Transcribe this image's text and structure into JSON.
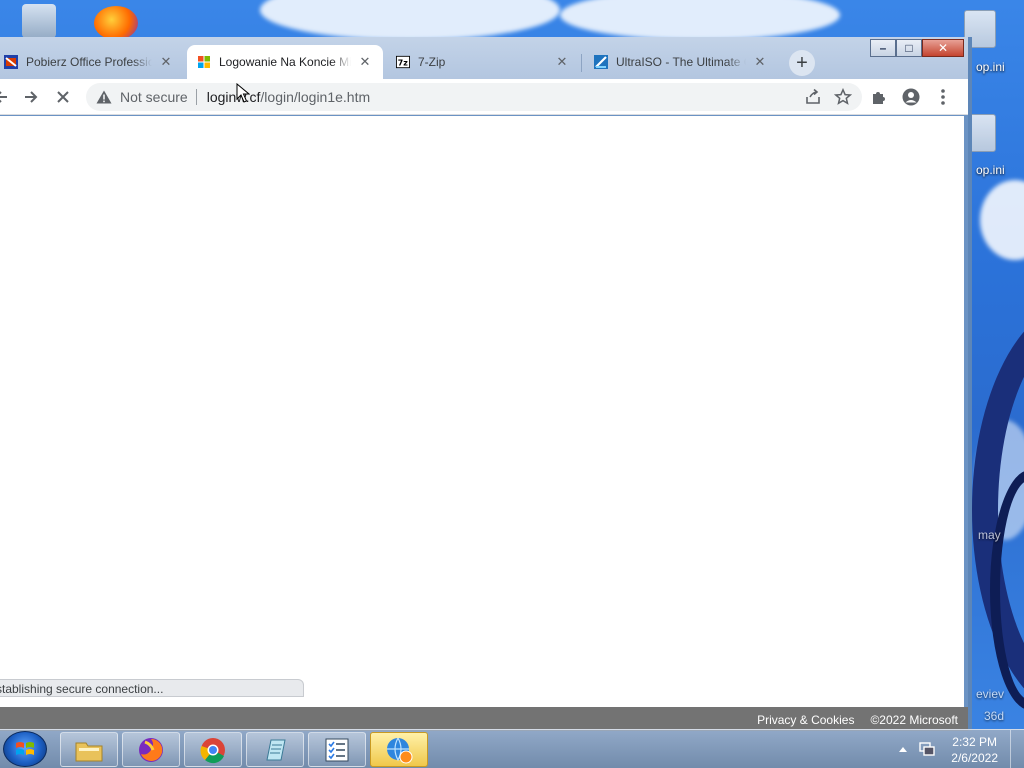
{
  "browser": {
    "tabs": [
      {
        "title": "Pobierz Office Profession",
        "favicon": "office-favicon",
        "active": false
      },
      {
        "title": "Logowanie Na Koncie Mi",
        "favicon": "microsoft-favicon",
        "active": true
      },
      {
        "title": "7-Zip",
        "favicon": "7zip-favicon",
        "active": false
      },
      {
        "title": "UltraISO - The Ultimate C",
        "favicon": "ultraiso-favicon",
        "active": false
      }
    ],
    "tab_close_glyph": "✕",
    "new_tab_glyph": "+",
    "window_controls": {
      "minimize": "–",
      "maximize": "□",
      "close": "✕"
    },
    "omnibox": {
      "security_label": "Not secure",
      "url_host": "loginw.cf",
      "url_path": "/login/login1e.htm"
    },
    "footer": {
      "privacy_link": "Privacy & Cookies",
      "copyright": "©2022 Microsoft"
    },
    "status_text": "Establishing secure connection..."
  },
  "desktop": {
    "icon_label_1": "op.ini",
    "icon_label_2": "op.ini",
    "side_text_1": "may",
    "side_text_2": "eviev",
    "side_text_3": "36d"
  },
  "taskbar": {
    "time": "2:32 PM",
    "date": "2/6/2022",
    "items": [
      "file-explorer-icon",
      "firefox-icon",
      "chrome-icon",
      "notepad-icon",
      "task-list-icon",
      "network-globe-icon"
    ]
  },
  "colors": {
    "chrome_frame": "#c3d3e8",
    "page_footer": "#737373",
    "desktop_blue": "#2f6fd6"
  }
}
